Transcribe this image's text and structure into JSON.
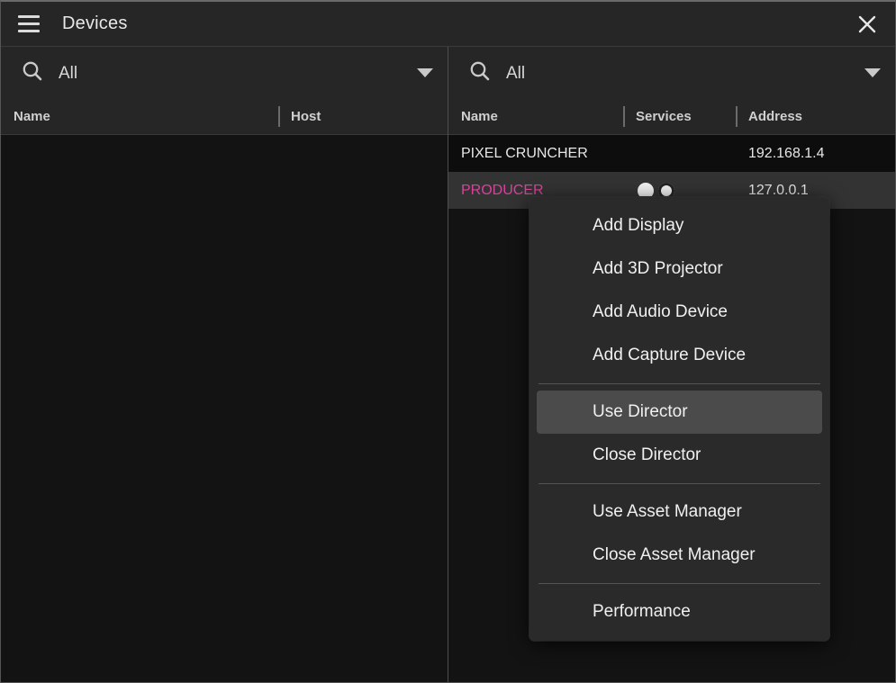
{
  "window": {
    "title": "Devices",
    "menu_icon": "hamburger-icon",
    "close_icon": "close-icon"
  },
  "left_pane": {
    "search": {
      "icon": "search-icon",
      "value": "All",
      "placeholder": "All",
      "dropdown_icon": "chevron-down-icon"
    },
    "columns": [
      "Name",
      "Host"
    ],
    "rows": []
  },
  "right_pane": {
    "search": {
      "icon": "search-icon",
      "value": "All",
      "placeholder": "All",
      "dropdown_icon": "chevron-down-icon"
    },
    "columns": [
      "Name",
      "Services",
      "Address"
    ],
    "rows": [
      {
        "name": "PIXEL CRUNCHER",
        "services": [],
        "address": "192.168.1.4",
        "selected": false
      },
      {
        "name": "PRODUCER",
        "services": [
          "service-dot-icon",
          "service-ring-icon"
        ],
        "address": "127.0.0.1",
        "selected": true
      }
    ]
  },
  "context_menu": {
    "groups": [
      {
        "items": [
          {
            "label": "Add Display",
            "highlight": false
          },
          {
            "label": "Add 3D Projector",
            "highlight": false
          },
          {
            "label": "Add Audio Device",
            "highlight": false
          },
          {
            "label": "Add Capture Device",
            "highlight": false
          }
        ]
      },
      {
        "items": [
          {
            "label": "Use Director",
            "highlight": true
          },
          {
            "label": "Close Director",
            "highlight": false
          }
        ]
      },
      {
        "items": [
          {
            "label": "Use Asset Manager",
            "highlight": false
          },
          {
            "label": "Close Asset Manager",
            "highlight": false
          }
        ]
      },
      {
        "items": [
          {
            "label": "Performance",
            "highlight": false
          }
        ]
      }
    ]
  },
  "colors": {
    "accent_selected_text": "#d6439b",
    "window_bg": "#2b2b2b",
    "pane_bg": "#262626",
    "list_bg": "#131313",
    "menu_bg": "#2a2a2a",
    "menu_highlight": "#4b4b4b"
  }
}
